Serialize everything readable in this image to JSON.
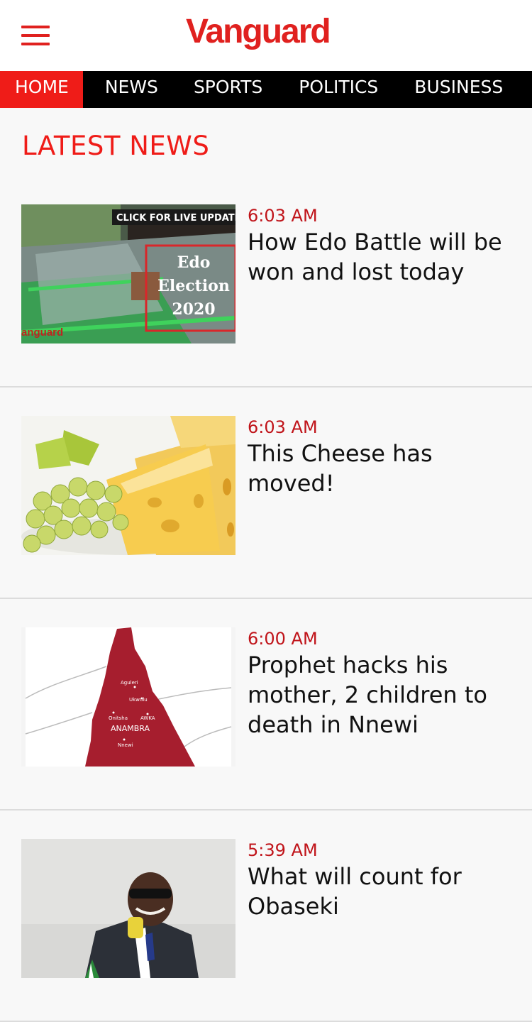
{
  "header": {
    "logo_text": "Vanguard",
    "menu_icon": "hamburger-icon",
    "brand_color": "#e0211f"
  },
  "nav": {
    "items": [
      {
        "label": "HOME",
        "active": true
      },
      {
        "label": "NEWS",
        "active": false
      },
      {
        "label": "SPORTS",
        "active": false
      },
      {
        "label": "POLITICS",
        "active": false
      },
      {
        "label": "BUSINESS",
        "active": false
      }
    ]
  },
  "section": {
    "title": "LATEST NEWS"
  },
  "articles": [
    {
      "time": "6:03 AM",
      "title": "How Edo Battle will be won and lost today",
      "image_text": {
        "banner": "CLICK FOR LIVE UPDATE",
        "line1": "Edo",
        "line2": "Election",
        "line3": "2020",
        "watermark": "anguard"
      }
    },
    {
      "time": "6:03 AM",
      "title": "This Cheese has moved!"
    },
    {
      "time": "6:00 AM",
      "title": "Prophet hacks his mother, 2 children to death in Nnewi",
      "map_labels": {
        "aguleri": "Aguleri",
        "ukwulu": "Ukwulu",
        "onitsha": "Onitsha",
        "awka": "AWKA",
        "state": "ANAMBRA",
        "nnewi": "Nnewi"
      }
    },
    {
      "time": "5:39 AM",
      "title": "What will count for Obaseki"
    }
  ],
  "colors": {
    "accent": "#ef1c18",
    "time": "#c0141a",
    "nav_bg": "#000000",
    "page_bg": "#f8f8f8"
  }
}
